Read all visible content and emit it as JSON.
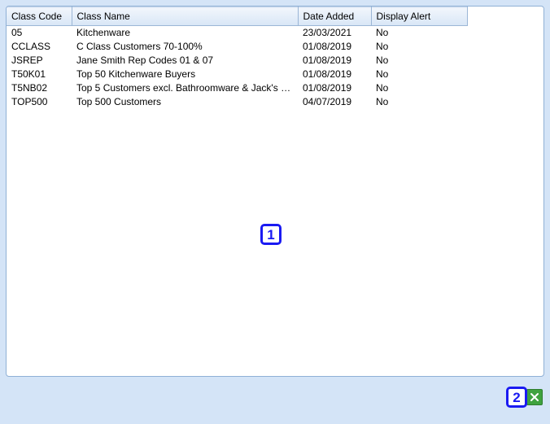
{
  "columns": {
    "code": "Class Code",
    "name": "Class Name",
    "date": "Date Added",
    "alert": "Display Alert"
  },
  "rows": [
    {
      "code": "05",
      "name": "Kitchenware",
      "date": "23/03/2021",
      "alert": "No"
    },
    {
      "code": "CCLASS",
      "name": "C Class Customers 70-100%",
      "date": "01/08/2019",
      "alert": "No"
    },
    {
      "code": "JSREP",
      "name": "Jane Smith Rep Codes 01 & 07",
      "date": "01/08/2019",
      "alert": "No"
    },
    {
      "code": "T50K01",
      "name": "Top 50 Kitchenware Buyers",
      "date": "01/08/2019",
      "alert": "No"
    },
    {
      "code": "T5NB02",
      "name": "Top 5 Customers excl. Bathroomware & Jack's s...",
      "date": "01/08/2019",
      "alert": "No"
    },
    {
      "code": "TOP500",
      "name": "Top 500 Customers",
      "date": "04/07/2019",
      "alert": "No"
    }
  ],
  "callouts": {
    "one": "1",
    "two": "2"
  },
  "icons": {
    "excel": "excel-icon"
  }
}
